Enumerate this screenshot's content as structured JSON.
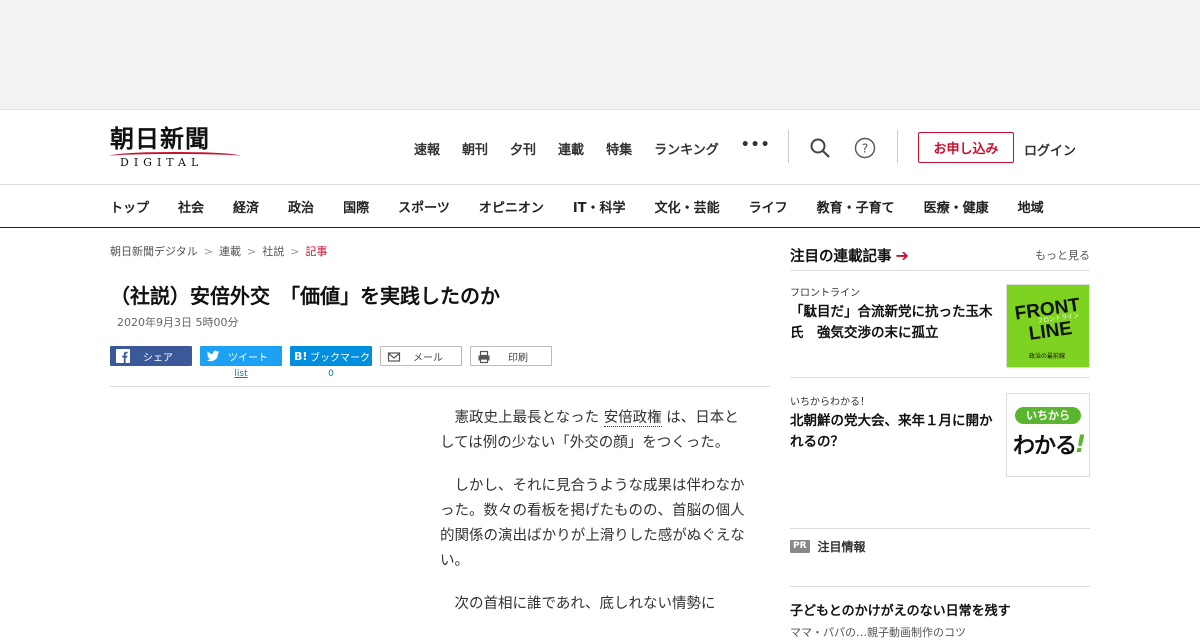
{
  "header": {
    "logo_main": "朝日新聞",
    "logo_sub": "DIGITAL",
    "nav": [
      "速報",
      "朝刊",
      "夕刊",
      "連載",
      "特集",
      "ランキング"
    ],
    "more": "•••",
    "apply": "お申し込み",
    "login": "ログイン"
  },
  "categories": [
    "トップ",
    "社会",
    "経済",
    "政治",
    "国際",
    "スポーツ",
    "オピニオン",
    "IT・科学",
    "文化・芸能",
    "ライフ",
    "教育・子育て",
    "医療・健康",
    "地域"
  ],
  "breadcrumb": [
    "朝日新聞デジタル",
    "連載",
    "社説",
    "記事"
  ],
  "article": {
    "title": "（社説）安倍外交　「価値」を実践したのか",
    "date": "2020年9月3日 5時00分",
    "share": {
      "facebook": "シェア",
      "twitter": "ツイート",
      "twitter_count": "list",
      "hatena": "ブックマーク",
      "hatena_prefix": "B!",
      "hatena_count": "0",
      "mail": "メール",
      "print": "印刷"
    },
    "p1_a": "憲政史上最長となった",
    "p1_link": "安倍政権",
    "p1_b": "は、日本としては例の少ない「外交の顔」をつくった。",
    "p2": "しかし、それに見合うような成果は伴わなかった。数々の看板を掲げたものの、首脳の個人的関係の演出ばかりが上滑りした感がぬぐえない。",
    "p3": "次の首相に誰であれ、底しれない情勢に"
  },
  "sidebar": {
    "heading": "注目の連載記事",
    "arrow": "➔",
    "more": "もっと見る",
    "cards": [
      {
        "category": "フロントライン",
        "title": "「駄目だ」合流新党に抗った玉木氏　強気交渉の末に孤立",
        "thumb_line1": "FRONT",
        "thumb_line2": "LINE",
        "thumb_small": "フロントライン",
        "thumb_bottom": "政治の最前線"
      },
      {
        "category": "いちからわかる！",
        "title": "北朝鮮の党大会、来年１月に開かれるの？",
        "thumb_top": "いちから",
        "thumb_main": "わかる",
        "thumb_mark": "!"
      }
    ],
    "pr_badge": "PR",
    "pr_label": "注目情報",
    "bottom_title": "子どもとのかけがえのない日常を残す",
    "bottom_sub": "ママ・パパの…親子動画制作のコツ"
  },
  "colors": {
    "accent": "#c8102e",
    "facebook": "#3b5998",
    "twitter": "#1da1f2",
    "hatena": "#008fde",
    "frontline_bg": "#7ed321"
  }
}
